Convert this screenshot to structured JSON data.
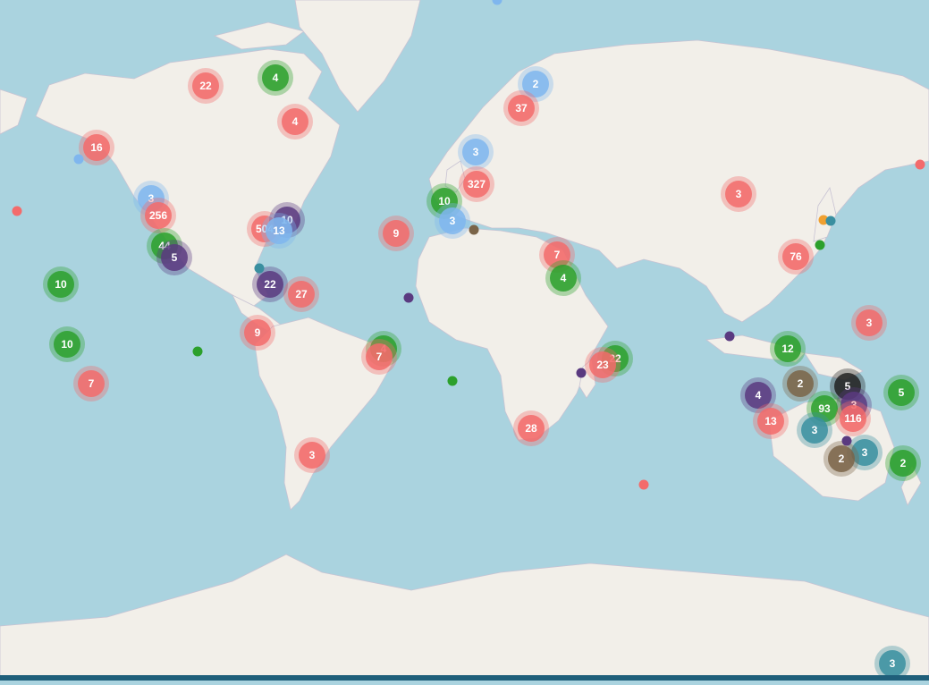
{
  "map": {
    "colors": {
      "water": "#aad3df",
      "land": "#f2efe9",
      "border": "#c8c3d3",
      "red": "#f36b6b",
      "green": "#2ca02c",
      "blue": "#7fb6ee",
      "purple": "#5a3a80",
      "teal": "#3a8fa0",
      "brown": "#7a6448",
      "pink": "#f4a9a8",
      "black": "#222222",
      "orange": "#f0a030"
    },
    "clusters": [
      {
        "label": "22",
        "color": "red"
      },
      {
        "label": "4",
        "color": "green"
      },
      {
        "label": "4",
        "color": "red"
      },
      {
        "label": "16",
        "color": "red"
      },
      {
        "label": "3",
        "color": "blue"
      },
      {
        "label": "256",
        "color": "red"
      },
      {
        "label": "44",
        "color": "green"
      },
      {
        "label": "5",
        "color": "purple"
      },
      {
        "label": "504",
        "color": "red"
      },
      {
        "label": "10",
        "color": "purple"
      },
      {
        "label": "13",
        "color": "blue"
      },
      {
        "label": "22",
        "color": "purple"
      },
      {
        "label": "27",
        "color": "red"
      },
      {
        "label": "10",
        "color": "green"
      },
      {
        "label": "10",
        "color": "green"
      },
      {
        "label": "7",
        "color": "red"
      },
      {
        "label": "9",
        "color": "red"
      },
      {
        "label": "9",
        "color": "red"
      },
      {
        "label": "4",
        "color": "green"
      },
      {
        "label": "7",
        "color": "red"
      },
      {
        "label": "3",
        "color": "red"
      },
      {
        "label": "2",
        "color": "blue"
      },
      {
        "label": "37",
        "color": "red"
      },
      {
        "label": "3",
        "color": "blue"
      },
      {
        "label": "327",
        "color": "red"
      },
      {
        "label": "10",
        "color": "green"
      },
      {
        "label": "3",
        "color": "blue"
      },
      {
        "label": "7",
        "color": "red"
      },
      {
        "label": "4",
        "color": "green"
      },
      {
        "label": "22",
        "color": "green"
      },
      {
        "label": "23",
        "color": "red"
      },
      {
        "label": "28",
        "color": "red"
      },
      {
        "label": "3",
        "color": "red"
      },
      {
        "label": "76",
        "color": "red"
      },
      {
        "label": "3",
        "color": "red"
      },
      {
        "label": "12",
        "color": "green"
      },
      {
        "label": "4",
        "color": "purple"
      },
      {
        "label": "2",
        "color": "brown"
      },
      {
        "label": "5",
        "color": "black"
      },
      {
        "label": "5",
        "color": "green"
      },
      {
        "label": "3",
        "color": "purple"
      },
      {
        "label": "93",
        "color": "green"
      },
      {
        "label": "116",
        "color": "red"
      },
      {
        "label": "13",
        "color": "red"
      },
      {
        "label": "3",
        "color": "teal"
      },
      {
        "label": "3",
        "color": "teal"
      },
      {
        "label": "2",
        "color": "brown"
      },
      {
        "label": "2",
        "color": "green"
      },
      {
        "label": "3",
        "color": "teal"
      }
    ],
    "markers": [
      {
        "color": "red"
      },
      {
        "color": "red"
      },
      {
        "color": "purple"
      },
      {
        "color": "green"
      },
      {
        "color": "green"
      },
      {
        "color": "purple"
      },
      {
        "color": "red"
      },
      {
        "color": "brown"
      },
      {
        "color": "orange"
      },
      {
        "color": "teal"
      },
      {
        "color": "green"
      },
      {
        "color": "purple"
      },
      {
        "color": "purple"
      },
      {
        "color": "blue"
      },
      {
        "color": "blue"
      },
      {
        "color": "teal"
      }
    ]
  }
}
